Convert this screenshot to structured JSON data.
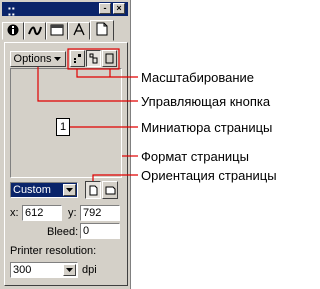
{
  "tabs": [
    {
      "name": "info-tab"
    },
    {
      "name": "brush-tab"
    },
    {
      "name": "frame-tab"
    },
    {
      "name": "text-tab"
    },
    {
      "name": "document-tab"
    }
  ],
  "toolbar": {
    "options_label": "Options"
  },
  "thumbnail": {
    "page_number": "1"
  },
  "page_format": {
    "selected": "Custom"
  },
  "dimensions": {
    "x_label": "x:",
    "x_value": "612",
    "y_label": "y:",
    "y_value": "792",
    "bleed_label": "Bleed:",
    "bleed_value": "0"
  },
  "printer_resolution": {
    "label": "Printer resolution:",
    "value": "300",
    "unit": "dpi"
  },
  "callouts": {
    "scaling": "Масштабирование",
    "control_button": "Управляющая кнопка",
    "page_thumbnail": "Миниатюра страницы",
    "page_format": "Формат страницы",
    "page_orientation": "Ориентация страницы"
  }
}
